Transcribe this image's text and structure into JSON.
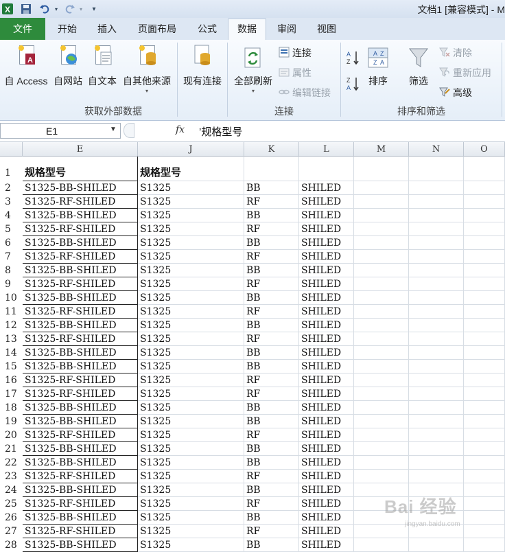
{
  "window": {
    "title": "文档1  [兼容模式] - M",
    "app_icon": "excel-icon",
    "qat": [
      "save-icon",
      "undo-icon",
      "redo-icon",
      "customize-qat-icon"
    ]
  },
  "tabs": {
    "file": "文件",
    "home": "开始",
    "insert": "插入",
    "page_layout": "页面布局",
    "formulas": "公式",
    "data": "数据",
    "review": "审阅",
    "view": "视图"
  },
  "ribbon": {
    "get_external_data": {
      "label": "获取外部数据",
      "from_access": "自 Access",
      "from_web": "自网站",
      "from_text": "自文本",
      "from_other": "自其他来源",
      "existing_connections": "现有连接"
    },
    "connections": {
      "label": "连接",
      "refresh_all": "全部刷新",
      "connections": "连接",
      "properties": "属性",
      "edit_links": "编辑链接"
    },
    "sort_filter": {
      "label": "排序和筛选",
      "sort": "排序",
      "filter": "筛选",
      "clear": "清除",
      "reapply": "重新应用",
      "advanced": "高级"
    }
  },
  "formula_bar": {
    "name_box": "E1",
    "fx": "fx",
    "formula": "’规格型号"
  },
  "columns": [
    "E",
    "J",
    "K",
    "L",
    "M",
    "N",
    "O"
  ],
  "sheet": {
    "header_row": {
      "row": "1",
      "E": "规格型号",
      "J": "规格型号",
      "K": "",
      "L": ""
    },
    "rows": [
      {
        "row": "2",
        "E": "S1325-BB-SHILED",
        "J": "S1325",
        "K": "BB",
        "L": "SHILED"
      },
      {
        "row": "3",
        "E": "S1325-RF-SHILED",
        "J": "S1325",
        "K": "RF",
        "L": "SHILED"
      },
      {
        "row": "4",
        "E": "S1325-BB-SHILED",
        "J": "S1325",
        "K": "BB",
        "L": "SHILED"
      },
      {
        "row": "5",
        "E": "S1325-RF-SHILED",
        "J": "S1325",
        "K": "RF",
        "L": "SHILED"
      },
      {
        "row": "6",
        "E": "S1325-BB-SHILED",
        "J": "S1325",
        "K": "BB",
        "L": "SHILED"
      },
      {
        "row": "7",
        "E": "S1325-RF-SHILED",
        "J": "S1325",
        "K": "RF",
        "L": "SHILED"
      },
      {
        "row": "8",
        "E": "S1325-BB-SHILED",
        "J": "S1325",
        "K": "BB",
        "L": "SHILED"
      },
      {
        "row": "9",
        "E": "S1325-RF-SHILED",
        "J": "S1325",
        "K": "RF",
        "L": "SHILED"
      },
      {
        "row": "10",
        "E": "S1325-BB-SHILED",
        "J": "S1325",
        "K": "BB",
        "L": "SHILED"
      },
      {
        "row": "11",
        "E": "S1325-RF-SHILED",
        "J": "S1325",
        "K": "RF",
        "L": "SHILED"
      },
      {
        "row": "12",
        "E": "S1325-BB-SHILED",
        "J": "S1325",
        "K": "BB",
        "L": "SHILED"
      },
      {
        "row": "13",
        "E": "S1325-RF-SHILED",
        "J": "S1325",
        "K": "RF",
        "L": "SHILED"
      },
      {
        "row": "14",
        "E": "S1325-BB-SHILED",
        "J": "S1325",
        "K": "BB",
        "L": "SHILED"
      },
      {
        "row": "15",
        "E": "S1325-BB-SHILED",
        "J": "S1325",
        "K": "BB",
        "L": "SHILED"
      },
      {
        "row": "16",
        "E": "S1325-RF-SHILED",
        "J": "S1325",
        "K": "RF",
        "L": "SHILED"
      },
      {
        "row": "17",
        "E": "S1325-RF-SHILED",
        "J": "S1325",
        "K": "RF",
        "L": "SHILED"
      },
      {
        "row": "18",
        "E": "S1325-BB-SHILED",
        "J": "S1325",
        "K": "BB",
        "L": "SHILED"
      },
      {
        "row": "19",
        "E": "S1325-BB-SHILED",
        "J": "S1325",
        "K": "BB",
        "L": "SHILED"
      },
      {
        "row": "20",
        "E": "S1325-RF-SHILED",
        "J": "S1325",
        "K": "RF",
        "L": "SHILED"
      },
      {
        "row": "21",
        "E": "S1325-BB-SHILED",
        "J": "S1325",
        "K": "BB",
        "L": "SHILED"
      },
      {
        "row": "22",
        "E": "S1325-BB-SHILED",
        "J": "S1325",
        "K": "BB",
        "L": "SHILED"
      },
      {
        "row": "23",
        "E": "S1325-RF-SHILED",
        "J": "S1325",
        "K": "RF",
        "L": "SHILED"
      },
      {
        "row": "24",
        "E": "S1325-BB-SHILED",
        "J": "S1325",
        "K": "BB",
        "L": "SHILED"
      },
      {
        "row": "25",
        "E": "S1325-RF-SHILED",
        "J": "S1325",
        "K": "RF",
        "L": "SHILED"
      },
      {
        "row": "26",
        "E": "S1325-BB-SHILED",
        "J": "S1325",
        "K": "BB",
        "L": "SHILED"
      },
      {
        "row": "27",
        "E": "S1325-RF-SHILED",
        "J": "S1325",
        "K": "RF",
        "L": "SHILED"
      },
      {
        "row": "28",
        "E": "S1325-BB-SHILED",
        "J": "S1325",
        "K": "BB",
        "L": "SHILED"
      }
    ]
  },
  "watermark": {
    "text": "Bai 经验",
    "sub": "jingyan.baidu.com"
  },
  "colors": {
    "file_tab": "#2e8b3c",
    "ribbon_bg": "#eaf1fa",
    "accent": "#3b6fb0"
  }
}
